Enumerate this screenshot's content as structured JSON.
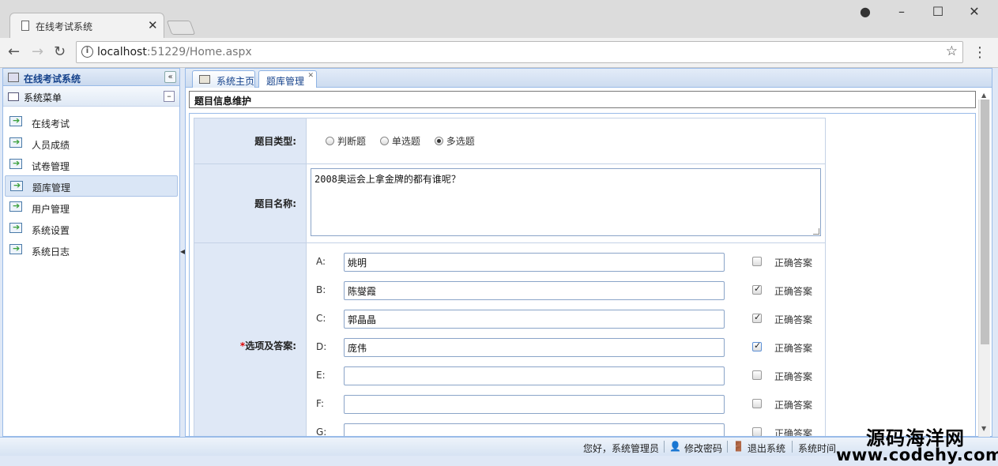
{
  "browser": {
    "tab_title": "在线考试系统",
    "tab_close": "✕",
    "url_host": "localhost",
    "url_rest": ":51229/Home.aspx",
    "win_min": "–",
    "win_max": "☐",
    "win_close": "✕",
    "back": "←",
    "forward": "→",
    "reload": "↻",
    "star": "☆",
    "menu": "⋮",
    "account": "●"
  },
  "west": {
    "title": "在线考试系统",
    "collapse": "«",
    "section": "系统菜单",
    "section_toggle": "–",
    "items": [
      {
        "label": "在线考试"
      },
      {
        "label": "人员成绩"
      },
      {
        "label": "试卷管理"
      },
      {
        "label": "题库管理",
        "active": true
      },
      {
        "label": "用户管理"
      },
      {
        "label": "系统设置"
      },
      {
        "label": "系统日志"
      }
    ]
  },
  "center": {
    "tabs": [
      {
        "label": "系统主页"
      },
      {
        "label": "题库管理",
        "closable": true
      }
    ],
    "page_title": "题目信息维护",
    "form": {
      "type_label": "题目类型:",
      "types": [
        "判断题",
        "单选题",
        "多选题"
      ],
      "selected_type": "多选题",
      "name_label": "题目名称:",
      "name_value": "2008奥运会上拿金牌的都有谁呢？",
      "options_label": "选项及答案:",
      "required_mark": "*",
      "correct_label": "正确答案",
      "options": [
        {
          "key": "A:",
          "value": "姚明",
          "correct": false
        },
        {
          "key": "B:",
          "value": "陈燮霞",
          "correct": true
        },
        {
          "key": "C:",
          "value": "郭晶晶",
          "correct": true
        },
        {
          "key": "D:",
          "value": "庞伟",
          "correct": true
        },
        {
          "key": "E:",
          "value": "",
          "correct": false
        },
        {
          "key": "F:",
          "value": "",
          "correct": false
        },
        {
          "key": "G:",
          "value": "",
          "correct": false
        }
      ]
    }
  },
  "status": {
    "greeting": "您好，系统管理员",
    "change_pwd": "修改密码",
    "logout": "退出系统",
    "time_label": "系统时间"
  },
  "watermark": {
    "line1": "源码海洋网",
    "line2": "www.codehy.com"
  }
}
